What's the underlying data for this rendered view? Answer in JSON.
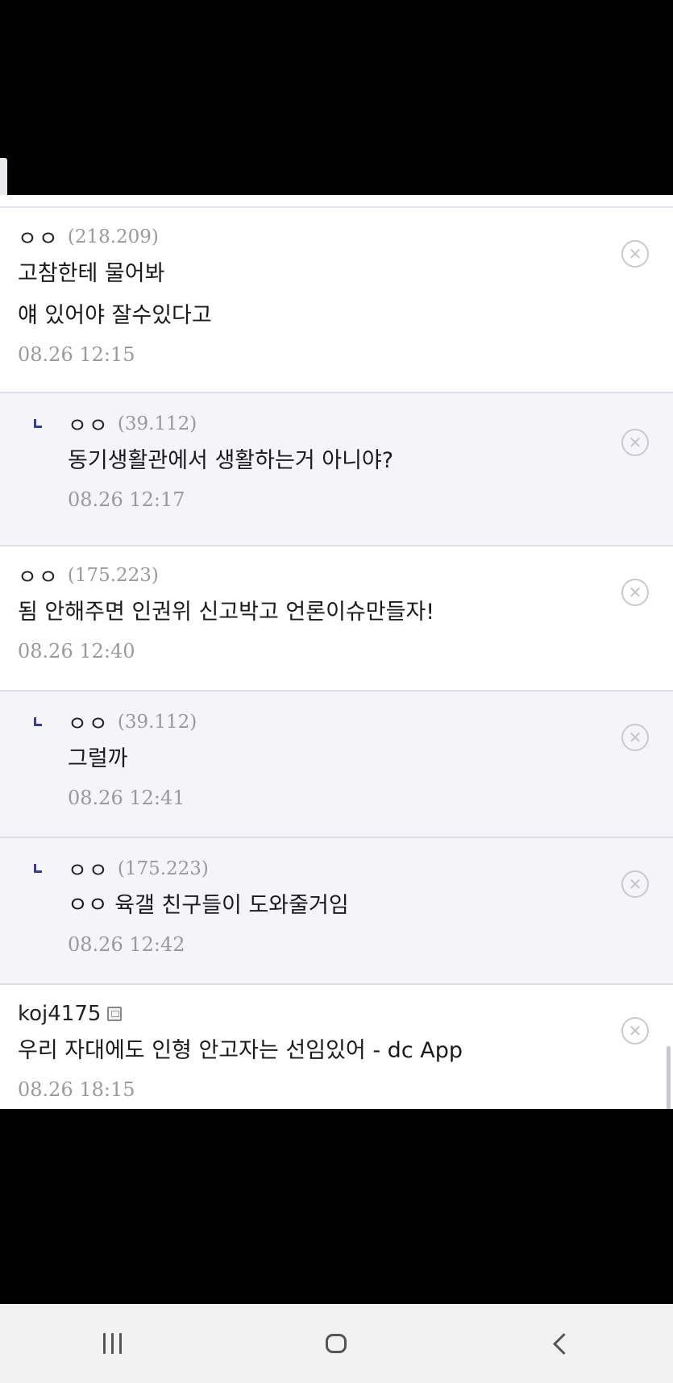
{
  "comments": [
    {
      "type": "root",
      "author": "ㅇㅇ",
      "ip": "(218.209)",
      "text": "고참한테 물어봐\n얘 있어야 잘수있다고",
      "date": "08.26 12:15"
    },
    {
      "type": "reply",
      "author": "ㅇㅇ",
      "ip": "(39.112)",
      "text": "동기생활관에서 생활하는거 아니야?",
      "date": "08.26 12:17"
    },
    {
      "type": "root",
      "author": "ㅇㅇ",
      "ip": "(175.223)",
      "text": "됨 안해주면 인권위 신고박고 언론이슈만들자!",
      "date": "08.26 12:40"
    },
    {
      "type": "reply",
      "author": "ㅇㅇ",
      "ip": "(39.112)",
      "text": "그럴까",
      "date": "08.26 12:41"
    },
    {
      "type": "reply",
      "author": "ㅇㅇ",
      "ip": "(175.223)",
      "text": "ㅇㅇ 육갤 친구들이 도와줄거임",
      "date": "08.26 12:42"
    },
    {
      "type": "root",
      "author": "koj4175",
      "ip": "",
      "text": "우리 자대에도 인형 안고자는 선임있어 - dc App",
      "date": "08.26 18:15"
    }
  ],
  "icons": {
    "delete": "delete-circle-x-icon",
    "reply": "reply-arrow-icon",
    "gallog": "gallog-icon"
  },
  "navbar": {
    "recent": "recent-apps-icon",
    "home": "home-icon",
    "back": "back-icon"
  },
  "colors": {
    "reply_bg": "#f4f4f9",
    "reply_mark": "#3b3f8a",
    "muted": "#9a9a9a"
  }
}
